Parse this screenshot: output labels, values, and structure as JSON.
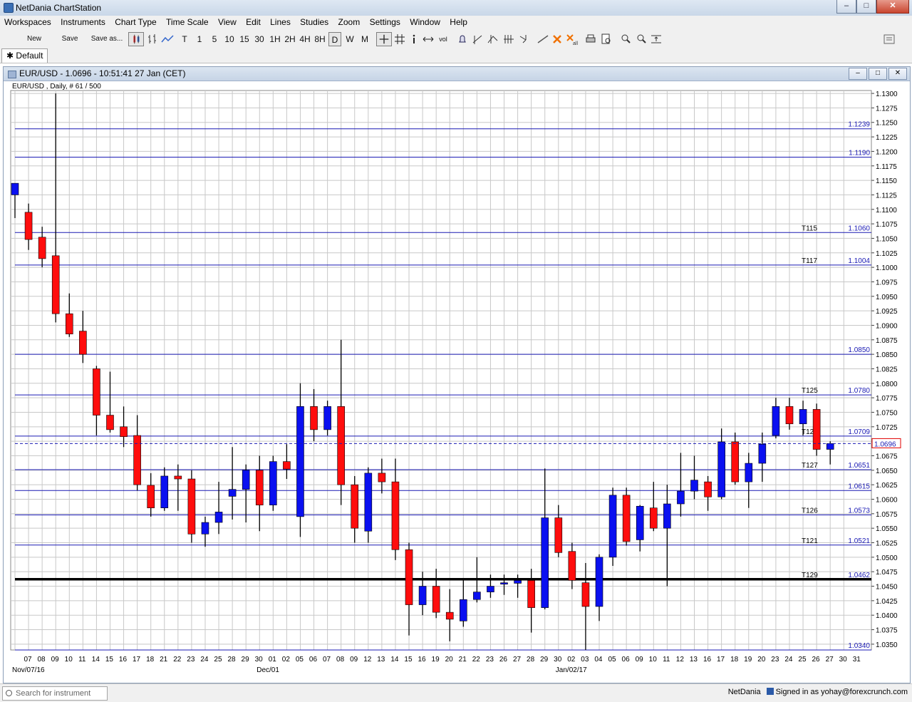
{
  "window": {
    "title": "NetDania ChartStation",
    "min": "–",
    "max": "□",
    "close": "✕"
  },
  "menu": [
    "Workspaces",
    "Instruments",
    "Chart Type",
    "Time Scale",
    "View",
    "Edit",
    "Lines",
    "Studies",
    "Zoom",
    "Settings",
    "Window",
    "Help"
  ],
  "toolbar": {
    "new": "New",
    "save": "Save",
    "save_as": "Save as...",
    "timeframes": [
      "T",
      "1",
      "5",
      "10",
      "15",
      "30",
      "1H",
      "2H",
      "4H",
      "8H",
      "D",
      "W",
      "M"
    ],
    "active_timeframe": "D",
    "vol": "vol"
  },
  "tab": {
    "label": "Default",
    "marker": "✱"
  },
  "chart_window": {
    "title": "EUR/USD - 1.0696 - 10:51:41  27 Jan (CET)"
  },
  "status": {
    "search_placeholder": "Search for instrument",
    "brand": "NetDania",
    "signed_in": "Signed in as yohay@forexcrunch.com"
  },
  "chart_data": {
    "type": "candlestick",
    "symbol_label": "EUR/USD , Daily, # 61 / 500",
    "last_price": "1.0696",
    "ylim": [
      1.034,
      1.1305
    ],
    "y_ticks": [
      "1.0350",
      "1.0375",
      "1.0400",
      "1.0425",
      "1.0450",
      "1.0475",
      "1.0500",
      "1.0525",
      "1.0550",
      "1.0575",
      "1.0600",
      "1.0625",
      "1.0650",
      "1.0675",
      "1.0700",
      "1.0725",
      "1.0750",
      "1.0775",
      "1.0800",
      "1.0825",
      "1.0850",
      "1.0875",
      "1.0900",
      "1.0925",
      "1.0950",
      "1.0975",
      "1.1000",
      "1.1025",
      "1.1050",
      "1.1075",
      "1.1100",
      "1.1125",
      "1.1150",
      "1.1175",
      "1.1200",
      "1.1225",
      "1.1250",
      "1.1275",
      "1.1300"
    ],
    "days": [
      "07",
      "08",
      "09",
      "10",
      "11",
      "14",
      "15",
      "16",
      "17",
      "18",
      "21",
      "22",
      "23",
      "24",
      "25",
      "28",
      "29",
      "30",
      "01",
      "02",
      "05",
      "06",
      "07",
      "08",
      "09",
      "12",
      "13",
      "14",
      "15",
      "16",
      "19",
      "20",
      "21",
      "22",
      "23",
      "26",
      "27",
      "28",
      "29",
      "30",
      "02",
      "03",
      "04",
      "05",
      "06",
      "09",
      "10",
      "11",
      "12",
      "13",
      "16",
      "17",
      "18",
      "19",
      "20",
      "23",
      "24",
      "25",
      "26",
      "27",
      "30",
      "31"
    ],
    "month_labels": [
      {
        "index": 0,
        "text": "Nov/07/16"
      },
      {
        "index": 18,
        "text": "Dec/01"
      },
      {
        "index": 40,
        "text": "Jan/02/17"
      }
    ],
    "candles": [
      {
        "o": 1.1125,
        "h": 1.1145,
        "l": 1.1085,
        "c": 1.1145
      },
      {
        "o": 1.1095,
        "h": 1.111,
        "l": 1.103,
        "c": 1.1048
      },
      {
        "o": 1.1052,
        "h": 1.107,
        "l": 1.1,
        "c": 1.1015
      },
      {
        "o": 1.102,
        "h": 1.13,
        "l": 1.0905,
        "c": 1.092
      },
      {
        "o": 1.092,
        "h": 1.0955,
        "l": 1.088,
        "c": 1.0885
      },
      {
        "o": 1.089,
        "h": 1.0925,
        "l": 1.0835,
        "c": 1.085
      },
      {
        "o": 1.0825,
        "h": 1.083,
        "l": 1.071,
        "c": 1.0745
      },
      {
        "o": 1.0745,
        "h": 1.082,
        "l": 1.0715,
        "c": 1.072
      },
      {
        "o": 1.0725,
        "h": 1.076,
        "l": 1.069,
        "c": 1.0708
      },
      {
        "o": 1.071,
        "h": 1.0745,
        "l": 1.0615,
        "c": 1.0625
      },
      {
        "o": 1.0624,
        "h": 1.0645,
        "l": 1.057,
        "c": 1.0585
      },
      {
        "o": 1.0585,
        "h": 1.0655,
        "l": 1.058,
        "c": 1.064
      },
      {
        "o": 1.064,
        "h": 1.066,
        "l": 1.058,
        "c": 1.0635
      },
      {
        "o": 1.0635,
        "h": 1.065,
        "l": 1.0525,
        "c": 1.054
      },
      {
        "o": 1.054,
        "h": 1.057,
        "l": 1.0518,
        "c": 1.056
      },
      {
        "o": 1.056,
        "h": 1.063,
        "l": 1.054,
        "c": 1.0578
      },
      {
        "o": 1.0605,
        "h": 1.069,
        "l": 1.0565,
        "c": 1.0617
      },
      {
        "o": 1.0617,
        "h": 1.066,
        "l": 1.056,
        "c": 1.065
      },
      {
        "o": 1.065,
        "h": 1.0675,
        "l": 1.0545,
        "c": 1.059
      },
      {
        "o": 1.059,
        "h": 1.0675,
        "l": 1.058,
        "c": 1.0665
      },
      {
        "o": 1.0665,
        "h": 1.0695,
        "l": 1.0635,
        "c": 1.0652
      },
      {
        "o": 1.057,
        "h": 1.08,
        "l": 1.0535,
        "c": 1.076
      },
      {
        "o": 1.076,
        "h": 1.079,
        "l": 1.07,
        "c": 1.072
      },
      {
        "o": 1.072,
        "h": 1.077,
        "l": 1.071,
        "c": 1.076
      },
      {
        "o": 1.076,
        "h": 1.0875,
        "l": 1.059,
        "c": 1.0625
      },
      {
        "o": 1.0625,
        "h": 1.064,
        "l": 1.0525,
        "c": 1.055
      },
      {
        "o": 1.0545,
        "h": 1.0655,
        "l": 1.0525,
        "c": 1.0645
      },
      {
        "o": 1.0645,
        "h": 1.067,
        "l": 1.061,
        "c": 1.063
      },
      {
        "o": 1.063,
        "h": 1.067,
        "l": 1.0495,
        "c": 1.0513
      },
      {
        "o": 1.0513,
        "h": 1.0525,
        "l": 1.0365,
        "c": 1.0418
      },
      {
        "o": 1.0418,
        "h": 1.0475,
        "l": 1.04,
        "c": 1.045
      },
      {
        "o": 1.045,
        "h": 1.048,
        "l": 1.0395,
        "c": 1.0405
      },
      {
        "o": 1.0405,
        "h": 1.0445,
        "l": 1.0355,
        "c": 1.0393
      },
      {
        "o": 1.039,
        "h": 1.046,
        "l": 1.038,
        "c": 1.0427
      },
      {
        "o": 1.0427,
        "h": 1.05,
        "l": 1.0422,
        "c": 1.044
      },
      {
        "o": 1.044,
        "h": 1.047,
        "l": 1.043,
        "c": 1.045
      },
      {
        "o": 1.0454,
        "h": 1.047,
        "l": 1.0435,
        "c": 1.0456
      },
      {
        "o": 1.0455,
        "h": 1.047,
        "l": 1.043,
        "c": 1.046
      },
      {
        "o": 1.046,
        "h": 1.048,
        "l": 1.037,
        "c": 1.0413
      },
      {
        "o": 1.0413,
        "h": 1.0653,
        "l": 1.041,
        "c": 1.0568
      },
      {
        "o": 1.0568,
        "h": 1.059,
        "l": 1.05,
        "c": 1.0508
      },
      {
        "o": 1.051,
        "h": 1.0525,
        "l": 1.0445,
        "c": 1.046
      },
      {
        "o": 1.0456,
        "h": 1.049,
        "l": 1.034,
        "c": 1.0415
      },
      {
        "o": 1.0415,
        "h": 1.0505,
        "l": 1.039,
        "c": 1.05
      },
      {
        "o": 1.05,
        "h": 1.062,
        "l": 1.0485,
        "c": 1.0607
      },
      {
        "o": 1.0607,
        "h": 1.062,
        "l": 1.052,
        "c": 1.0527
      },
      {
        "o": 1.053,
        "h": 1.059,
        "l": 1.051,
        "c": 1.0588
      },
      {
        "o": 1.0585,
        "h": 1.063,
        "l": 1.0545,
        "c": 1.055
      },
      {
        "o": 1.055,
        "h": 1.0625,
        "l": 1.045,
        "c": 1.0592
      },
      {
        "o": 1.0592,
        "h": 1.068,
        "l": 1.057,
        "c": 1.0614
      },
      {
        "o": 1.0614,
        "h": 1.0675,
        "l": 1.06,
        "c": 1.0633
      },
      {
        "o": 1.063,
        "h": 1.064,
        "l": 1.058,
        "c": 1.0604
      },
      {
        "o": 1.0604,
        "h": 1.0722,
        "l": 1.06,
        "c": 1.0699
      },
      {
        "o": 1.0699,
        "h": 1.0715,
        "l": 1.0625,
        "c": 1.063
      },
      {
        "o": 1.063,
        "h": 1.068,
        "l": 1.0585,
        "c": 1.0662
      },
      {
        "o": 1.0662,
        "h": 1.0715,
        "l": 1.063,
        "c": 1.0695
      },
      {
        "o": 1.071,
        "h": 1.0775,
        "l": 1.0705,
        "c": 1.076
      },
      {
        "o": 1.076,
        "h": 1.0775,
        "l": 1.072,
        "c": 1.073
      },
      {
        "o": 1.073,
        "h": 1.077,
        "l": 1.071,
        "c": 1.0755
      },
      {
        "o": 1.0755,
        "h": 1.0765,
        "l": 1.0675,
        "c": 1.0686
      },
      {
        "o": 1.0686,
        "h": 1.07,
        "l": 1.066,
        "c": 1.0696
      }
    ],
    "h_lines": [
      {
        "price": 1.1239,
        "label": "1.1239",
        "tag": ""
      },
      {
        "price": 1.119,
        "label": "1.1190",
        "tag": ""
      },
      {
        "price": 1.106,
        "label": "1.1060",
        "tag": "T115"
      },
      {
        "price": 1.1004,
        "label": "1.1004",
        "tag": "T117"
      },
      {
        "price": 1.085,
        "label": "1.0850",
        "tag": ""
      },
      {
        "price": 1.078,
        "label": "1.0780",
        "tag": "T125"
      },
      {
        "price": 1.0709,
        "label": "1.0709",
        "tag": "T123"
      },
      {
        "price": 1.0651,
        "label": "1.0651",
        "tag": "T127"
      },
      {
        "price": 1.0615,
        "label": "1.0615",
        "tag": ""
      },
      {
        "price": 1.0573,
        "label": "1.0573",
        "tag": "T126"
      },
      {
        "price": 1.0521,
        "label": "1.0521",
        "tag": "T121"
      },
      {
        "price": 1.0462,
        "label": "1.0462",
        "tag": "T129",
        "bold": true
      },
      {
        "price": 1.034,
        "label": "1.0340",
        "tag": ""
      }
    ],
    "colors": {
      "up": "#0a10f0",
      "down": "#ff0d0d",
      "grid": "#c8c8c8",
      "line": "#1a1ab4",
      "bold_line": "#000000",
      "price_tag": "#e00000"
    }
  }
}
